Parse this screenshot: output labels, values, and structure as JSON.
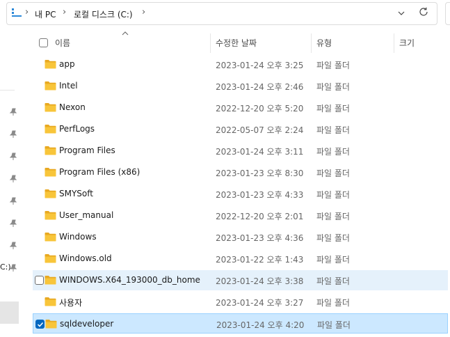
{
  "address": {
    "breadcrumb": [
      "내 PC",
      "로컬 디스크 (C:)"
    ]
  },
  "columns": {
    "name": "이름",
    "date": "수정한 날짜",
    "type": "유형",
    "size": "크기"
  },
  "nav": {
    "partial_label": "C:)"
  },
  "rows": [
    {
      "name": "app",
      "date": "2023-01-24 오후 3:25",
      "type": "파일 폴더"
    },
    {
      "name": "Intel",
      "date": "2023-01-24 오후 2:46",
      "type": "파일 폴더"
    },
    {
      "name": "Nexon",
      "date": "2022-12-20 오후 5:20",
      "type": "파일 폴더"
    },
    {
      "name": "PerfLogs",
      "date": "2022-05-07 오후 2:24",
      "type": "파일 폴더"
    },
    {
      "name": "Program Files",
      "date": "2023-01-24 오후 3:11",
      "type": "파일 폴더"
    },
    {
      "name": "Program Files (x86)",
      "date": "2023-01-23 오후 8:30",
      "type": "파일 폴더"
    },
    {
      "name": "SMYSoft",
      "date": "2023-01-23 오후 4:33",
      "type": "파일 폴더"
    },
    {
      "name": "User_manual",
      "date": "2022-12-20 오후 2:01",
      "type": "파일 폴더"
    },
    {
      "name": "Windows",
      "date": "2023-01-23 오후 4:36",
      "type": "파일 폴더"
    },
    {
      "name": "Windows.old",
      "date": "2023-01-22 오후 1:43",
      "type": "파일 폴더"
    },
    {
      "name": "WINDOWS.X64_193000_db_home",
      "date": "2023-01-24 오후 3:38",
      "type": "파일 폴더",
      "state": "hover"
    },
    {
      "name": "사용자",
      "date": "2023-01-24 오후 3:27",
      "type": "파일 폴더"
    },
    {
      "name": "sqldeveloper",
      "date": "2023-01-24 오후 4:20",
      "type": "파일 폴더",
      "state": "selected"
    }
  ],
  "colors": {
    "folder": "#f8c53a",
    "selected_bg": "#cce8ff",
    "hover_bg": "#e5f1fb",
    "accent": "#0067c0"
  }
}
